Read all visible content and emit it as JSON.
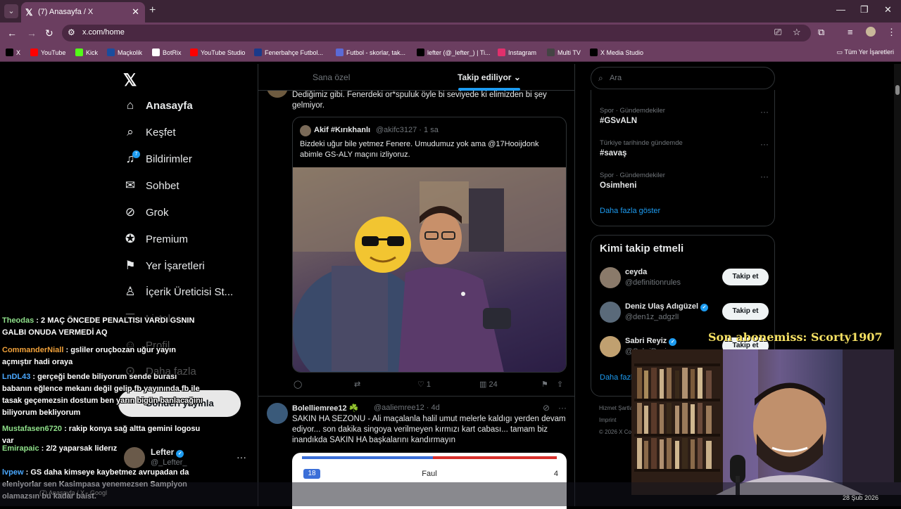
{
  "browser": {
    "tab_title": "(7) Anasayfa / X",
    "url": "x.com/home",
    "bookmarks": [
      {
        "label": "X",
        "icon": "x-icon",
        "color": "#000000"
      },
      {
        "label": "YouTube",
        "icon": "youtube-icon",
        "color": "#ff0000"
      },
      {
        "label": "Kick",
        "icon": "kick-icon",
        "color": "#53fc18"
      },
      {
        "label": "Maçkolik",
        "icon": "mackolik-icon",
        "color": "#1a4d9e"
      },
      {
        "label": "BotRix",
        "icon": "botrix-icon",
        "color": "#ffffff"
      },
      {
        "label": "YouTube Studio",
        "icon": "youtube-studio-icon",
        "color": "#ff0000"
      },
      {
        "label": "Fenerbahçe Futbol...",
        "icon": "fenerbahce-icon",
        "color": "#1b3a8a"
      },
      {
        "label": "Futbol - skorlar, tak...",
        "icon": "flashscore-icon",
        "color": "#5b6ad6"
      },
      {
        "label": "lefter (@_lefter_) | Ti...",
        "icon": "tiktok-icon",
        "color": "#000000"
      },
      {
        "label": "Instagram",
        "icon": "instagram-icon",
        "color": "#e1306c"
      },
      {
        "label": "Multi TV",
        "icon": "multitv-icon",
        "color": "#444444"
      },
      {
        "label": "X Media Studio",
        "icon": "x-media-icon",
        "color": "#000000"
      }
    ],
    "bookmarks_folder": "Tüm Yer İşaretleri"
  },
  "sidebar": {
    "items": [
      {
        "label": "Anasayfa",
        "icon": "home-icon"
      },
      {
        "label": "Keşfet",
        "icon": "search-icon"
      },
      {
        "label": "Bildirimler",
        "icon": "bell-icon",
        "badge": "7"
      },
      {
        "label": "Sohbet",
        "icon": "mail-icon"
      },
      {
        "label": "Grok",
        "icon": "grok-icon"
      },
      {
        "label": "Premium",
        "icon": "premium-icon"
      },
      {
        "label": "Yer İşaretleri",
        "icon": "bookmark-icon"
      },
      {
        "label": "İçerik Üreticisi St...",
        "icon": "creator-studio-icon"
      },
      {
        "label": "Listeler",
        "icon": "list-icon"
      },
      {
        "label": "Profil",
        "icon": "profile-icon"
      },
      {
        "label": "Daha fazla",
        "icon": "more-circle-icon"
      }
    ],
    "post_button": "Gönderi yayınla",
    "profile": {
      "name": "Lefter",
      "handle": "@_Lefter_"
    }
  },
  "chat": [
    {
      "user": "Theodas",
      "color": "#8fe08a",
      "text": ": 2 MAÇ ÖNCEDE PENALTISI VARDI GSNIN GALBI ONUDA VERMEDİ AQ"
    },
    {
      "user": "CommanderNiall",
      "color": "#f2a23a",
      "text": ": gsliler oruçbozan uğur yayın açmıştır hadi oraya"
    },
    {
      "user": "LnDL43",
      "color": "#4aa8ff",
      "text": ": gerçeği bende biliyorum sende burası babanın eğlence mekanı değil gelip fb yayınında fb ile tasak geçemezsin dostum ben yarın bigün banlacağını biliyorum bekliyorum"
    },
    {
      "user": "Mustafasen6720",
      "color": "#8fe08a",
      "text": ": rakip konya sağ altta gemini logosu var"
    },
    {
      "user": "Emirapaic",
      "color": "#8fe08a",
      "text": ": 2/2 yaparsak liderız"
    },
    {
      "user": "lvpew",
      "color": "#4aa8ff",
      "text": ": GS daha kimseye kaybetmez avrupadan da eleniyorlar sen Kasimpasa yenemezsen Sampiyon olamazsın bu kadar baist."
    }
  ],
  "feed": {
    "tabs": [
      "Sana özel",
      "Takip ediliyor"
    ],
    "tweet1": {
      "text": "Dediğimiz gibi. Fenerdeki or*spuluk öyle bi seviyede ki elimizden bi şey gelmiyor.",
      "quote": {
        "name": "Akif #Kırıkhanlı",
        "handle": "@akifc3127 · 1 sa",
        "text": "Bizdeki uğur bile yetmez Fenere. Umudumuz yok ama @17Hooijdonk abimle GS-ALY maçını izliyoruz."
      },
      "replies": "",
      "reposts": "",
      "likes": "1",
      "views": "24"
    },
    "tweet2": {
      "name": "Bolelliemree12 ☘️",
      "handle": "@aaliemree12 · 4d",
      "text": "SAKIN HA SEZONU - Ali maçalanla halil umut melerle kaldıgı yerden devam ediyor... son dakika singoya verilmeyen kırmızı kart cabası... tamam biz inandıkda SAKIN HA başkalarını kandırmayın",
      "stat_label": "Faul",
      "stat_left": "18",
      "stat_right": "4"
    }
  },
  "right": {
    "search_placeholder": "Ara",
    "trends": [
      {
        "context": "Spor · Gündemdekiler",
        "title": "#GSvALN"
      },
      {
        "context": "Türkiye tarihinde gündemde",
        "title": "#savaş"
      },
      {
        "context": "Spor · Gündemdekiler",
        "title": "Osimheni"
      }
    ],
    "show_more": "Daha fazla göster",
    "who_to_follow_title": "Kimi takip etmeli",
    "who_to_follow": [
      {
        "name": "ceyda",
        "handle": "@definitionrules",
        "verified": false
      },
      {
        "name": "Deniz Ulaş Adıgüzel",
        "handle": "@den1z_adgzlI",
        "verified": true
      },
      {
        "name": "Sabri Reyiz",
        "handle": "@SabriReyiz...",
        "verified": true
      }
    ],
    "follow_label": "Takip et",
    "wtf_more": "Daha fazla göster",
    "footer": [
      "Hizmet Şartları",
      "Imprint",
      "© 2026 X Corp."
    ]
  },
  "overlay": {
    "sub_banner": "Son abonemiss: Scorty1907"
  },
  "taskbar": {
    "date": "28 Şub 2026",
    "item": "(7) Anasayfa / X - Googl"
  }
}
